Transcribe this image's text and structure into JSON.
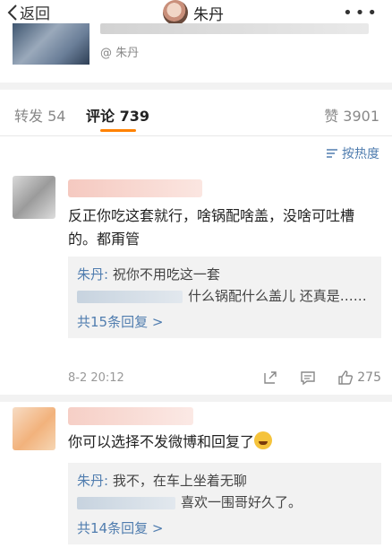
{
  "nav": {
    "back_label": "返回",
    "title": "朱丹",
    "more_label": "•••"
  },
  "post": {
    "author": "@ 朱丹"
  },
  "tabs": {
    "repost": "转发 54",
    "comment": "评论 739",
    "like": "赞 3901"
  },
  "sort": {
    "label": "按热度"
  },
  "comments": [
    {
      "text": "反正你吃这套就行，啥锅配啥盖，没啥可吐槽的。都甭管",
      "replies": [
        {
          "author": "朱丹:",
          "text": " 祝你不用吃这一套"
        },
        {
          "text": "什么锅配什么盖儿 还真是……"
        }
      ],
      "more_replies": "共15条回复 >",
      "time": "8-2 20:12",
      "likes": "275"
    },
    {
      "text": "你可以选择不发微博和回复了",
      "replies": [
        {
          "author": "朱丹:",
          "text": " 我不，在车上坐着无聊"
        },
        {
          "text": "喜欢一围哥好久了。"
        }
      ],
      "more_replies": "共14条回复 >"
    }
  ],
  "colors": {
    "accent": "#ff8200",
    "link": "#507daf",
    "divider": "#f2f2f2"
  }
}
